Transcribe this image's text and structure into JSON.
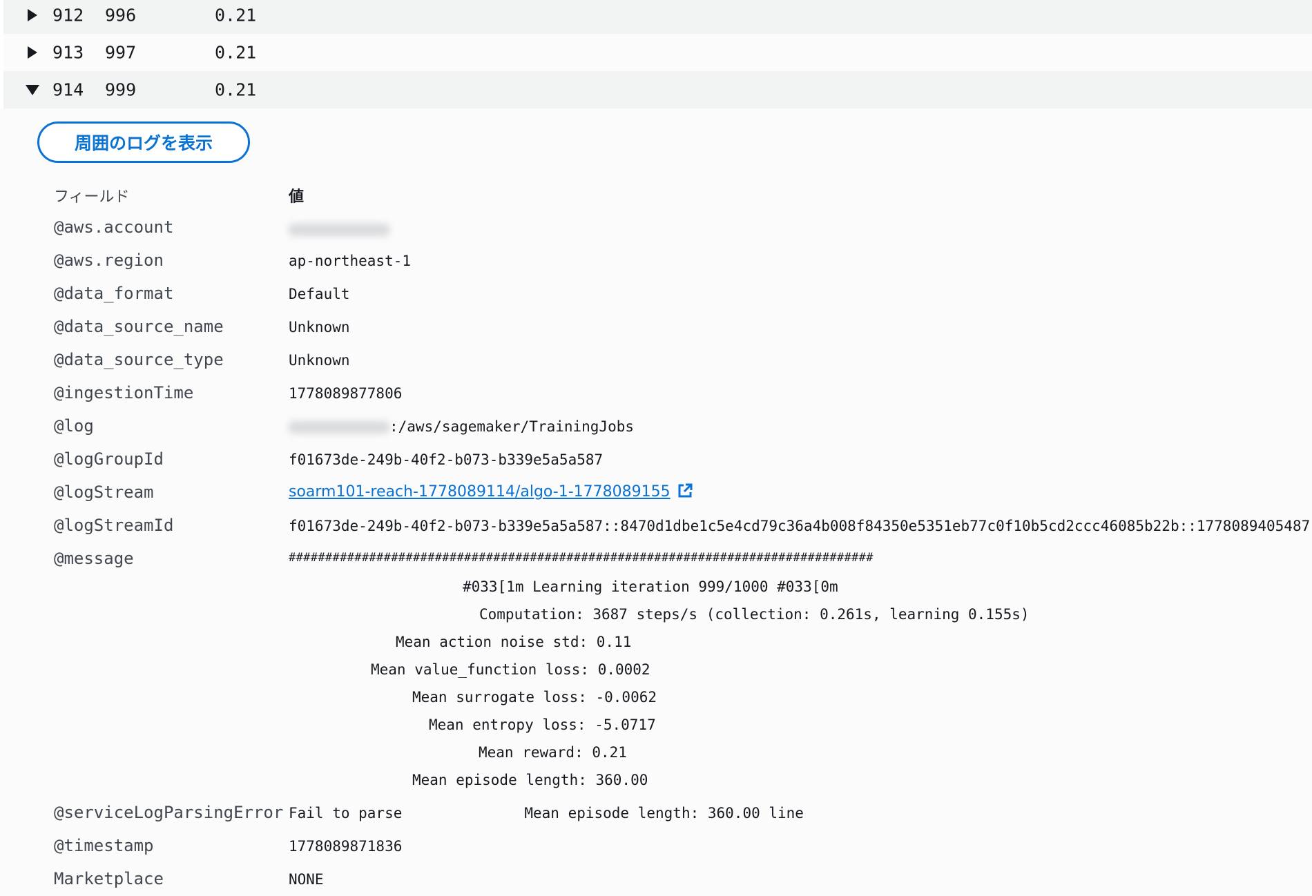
{
  "rows": [
    {
      "id": "912",
      "value": "996",
      "reward": "0.21",
      "expanded": false
    },
    {
      "id": "913",
      "value": "997",
      "reward": "0.21",
      "expanded": false
    },
    {
      "id": "914",
      "value": "999",
      "reward": "0.21",
      "expanded": true
    }
  ],
  "context_button_label": "周囲のログを表示",
  "details": {
    "field_header": "フィールド",
    "value_header": "値",
    "fields": {
      "aws_account": "@aws.account",
      "aws_region": "@aws.region",
      "data_format": "@data_format",
      "data_source_name": "@data_source_name",
      "data_source_type": "@data_source_type",
      "ingestion_time": "@ingestionTime",
      "log": "@log",
      "log_group_id": "@logGroupId",
      "log_stream": "@logStream",
      "log_stream_id": "@logStreamId",
      "message": "@message",
      "service_log_parsing_error": "@serviceLogParsingError",
      "timestamp": "@timestamp",
      "marketplace": "Marketplace"
    },
    "values": {
      "aws_region": "ap-northeast-1",
      "data_format": "Default",
      "data_source_name": "Unknown",
      "data_source_type": "Unknown",
      "ingestion_time": "1778089877806",
      "log_suffix": ":/aws/sagemaker/TrainingJobs",
      "log_group_id": "f01673de-249b-40f2-b073-b339e5a5a587",
      "log_stream": "soarm101-reach-1778089114/algo-1-1778089155",
      "log_stream_id": "f01673de-249b-40f2-b073-b339e5a5a587::8470d1dbe1c5e4cd79c36a4b008f84350e5351eb77c0f10b5cd2ccc46085b22b::1778089405487",
      "message_hashes": "################################################################################",
      "message_lines": [
        "#033[1m Learning iteration 999/1000 #033[0m",
        "Computation: 3687 steps/s (collection: 0.261s, learning 0.155s)",
        "Mean action noise std: 0.11",
        "Mean value_function loss: 0.0002",
        "Mean surrogate loss: -0.0062",
        "Mean entropy loss: -5.0717",
        "Mean reward: 0.21",
        "Mean episode length: 360.00"
      ],
      "service_log_parsing_error": "Fail to parse              Mean episode length: 360.00 line",
      "timestamp": "1778089871836",
      "marketplace": "NONE"
    }
  },
  "icons": {
    "collapsed_caret": "caret-right-icon",
    "expanded_caret": "caret-down-icon",
    "external_link": "external-link-icon"
  },
  "colors": {
    "link": "#0972d3",
    "row_shade": "#f2f3f3",
    "text": "#16191f"
  }
}
